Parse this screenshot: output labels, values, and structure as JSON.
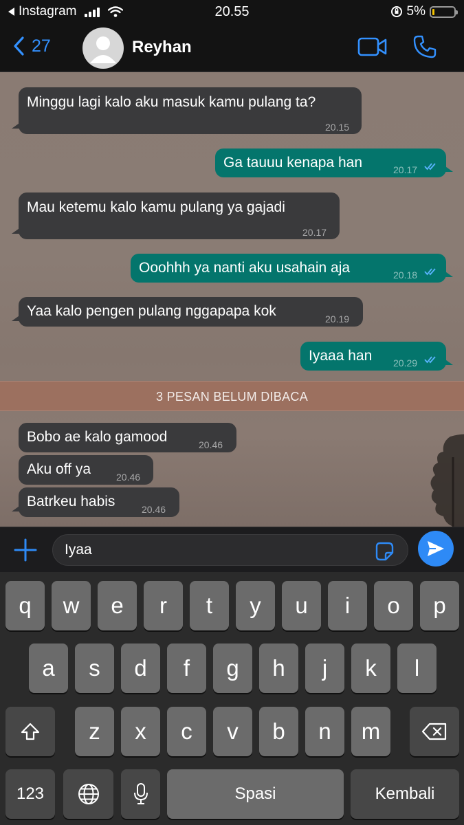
{
  "status_bar": {
    "back_app": "Instagram",
    "time": "20.55",
    "battery": "5%",
    "battery_level": 0.05
  },
  "header": {
    "back_count": "27",
    "contact_name": "Reyhan",
    "icons": [
      "chevron-left-icon",
      "avatar-placeholder",
      "video-camera-icon",
      "phone-icon"
    ]
  },
  "messages": [
    {
      "direction": "in",
      "text": "Minggu lagi kalo aku masuk kamu pulang ta?",
      "time": "20.15"
    },
    {
      "direction": "out",
      "text": "Ga tauuu kenapa han",
      "time": "20.17"
    },
    {
      "direction": "in",
      "text": "Mau ketemu kalo kamu pulang ya gajadi",
      "time": "20.17"
    },
    {
      "direction": "out",
      "text": "Ooohhh ya nanti aku usahain aja",
      "time": "20.18"
    },
    {
      "direction": "in",
      "text": "Yaa kalo pengen pulang nggapapa kok",
      "time": "20.19"
    },
    {
      "direction": "out",
      "text": "Iyaaa han",
      "time": "20.29"
    }
  ],
  "unread_banner": "3 PESAN BELUM DIBACA",
  "unread_messages": [
    {
      "direction": "in",
      "text": "Bobo ae kalo gamood",
      "time": "20.46"
    },
    {
      "direction": "in",
      "text": "Aku off ya",
      "time": "20.46"
    },
    {
      "direction": "in",
      "text": "Batrkeu habis",
      "time": "20.46"
    }
  ],
  "input": {
    "value": "Iyaa",
    "icons": [
      "plus-icon",
      "sticker-icon",
      "send-icon"
    ]
  },
  "keyboard": {
    "row1": [
      "q",
      "w",
      "e",
      "r",
      "t",
      "y",
      "u",
      "i",
      "o",
      "p"
    ],
    "row2": [
      "a",
      "s",
      "d",
      "f",
      "g",
      "h",
      "j",
      "k",
      "l"
    ],
    "row3": [
      "z",
      "x",
      "c",
      "v",
      "b",
      "n",
      "m"
    ],
    "numbers_label": "123",
    "space_label": "Spasi",
    "return_label": "Kembali"
  },
  "colors": {
    "accent": "#2e8af6",
    "bubble_in": "#3a3a3c",
    "bubble_out": "#04756c",
    "read_ticks": "#5ab4ff"
  }
}
